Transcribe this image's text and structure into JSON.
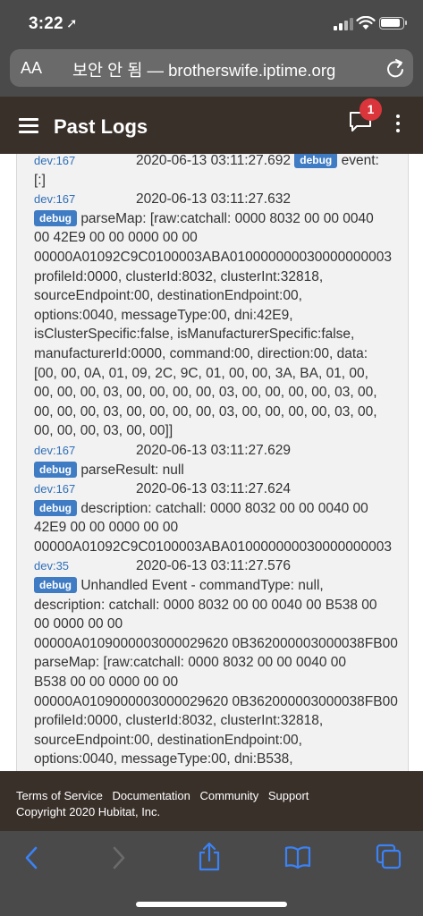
{
  "status_bar": {
    "time": "3:22",
    "location_glyph": "➚"
  },
  "url_bar": {
    "text_size_label": "AA",
    "url": "보안 안 됨 — brotherswife.iptime.org"
  },
  "header": {
    "title": "Past Logs",
    "notification_count": "1"
  },
  "logs": [
    {
      "dev": "dev:167",
      "time": "2020-06-13 03:11:27.692",
      "level": "debug",
      "inline": true,
      "lines": [
        "event:",
        "[:]"
      ]
    },
    {
      "dev": "dev:167",
      "time": "2020-06-13 03:11:27.632",
      "level": "debug",
      "inline": false,
      "lines": [
        "parseMap: [raw:catchall: 0000 8032 00 00 0040",
        "00 42E9 00 00 0000 00 00",
        "00000A01092C9C0100003ABA010000000030000000003",
        " profileId:0000, clusterId:8032, clusterInt:32818,",
        "sourceEndpoint:00, destinationEndpoint:00,",
        "options:0040, messageType:00, dni:42E9,",
        "isClusterSpecific:false, isManufacturerSpecific:false,",
        "manufacturerId:0000, command:00, direction:00, data:",
        "[00, 00, 0A, 01, 09, 2C, 9C, 01, 00, 00, 3A, BA, 01, 00,",
        "00, 00, 00, 03, 00, 00, 00, 00, 03, 00, 00, 00, 00, 03, 00,",
        "00, 00, 00, 03, 00, 00, 00, 00, 03, 00, 00, 00, 00, 03, 00,",
        "00, 00, 00, 03, 00, 00]]"
      ]
    },
    {
      "dev": "dev:167",
      "time": "2020-06-13 03:11:27.629",
      "level": "debug",
      "inline": false,
      "lines": [
        "parseResult: null"
      ]
    },
    {
      "dev": "dev:167",
      "time": "2020-06-13 03:11:27.624",
      "level": "debug",
      "inline": false,
      "lines": [
        "description: catchall: 0000 8032 00 00 0040 00",
        "42E9 00 00 0000 00 00",
        "00000A01092C9C0100003ABA010000000030000000003"
      ]
    },
    {
      "dev": "dev:35",
      "time": "2020-06-13 03:11:27.576",
      "level": "debug",
      "inline": false,
      "lines": [
        "Unhandled Event - commandType: null,",
        "description: catchall: 0000 8032 00 00 0040 00 B538 00",
        "00 0000 00 00",
        "00000A0109000003000029620 0B362000003000038FB00",
        " parseMap: [raw:catchall: 0000 8032 00 00 0040 00",
        "B538 00 00 0000 00 00",
        "00000A0109000003000029620 0B362000003000038FB00",
        " profileId:0000, clusterId:8032, clusterInt:32818,",
        "sourceEndpoint:00, destinationEndpoint:00,",
        "options:0040, messageType:00, dni:B538,"
      ]
    }
  ],
  "footer": {
    "links": [
      "Terms of Service",
      "Documentation",
      "Community",
      "Support"
    ],
    "copyright": "Copyright 2020 Hubitat, Inc."
  },
  "toolbar": {
    "icons": [
      "back-icon",
      "forward-icon",
      "share-icon",
      "bookmarks-icon",
      "tabs-icon"
    ]
  }
}
